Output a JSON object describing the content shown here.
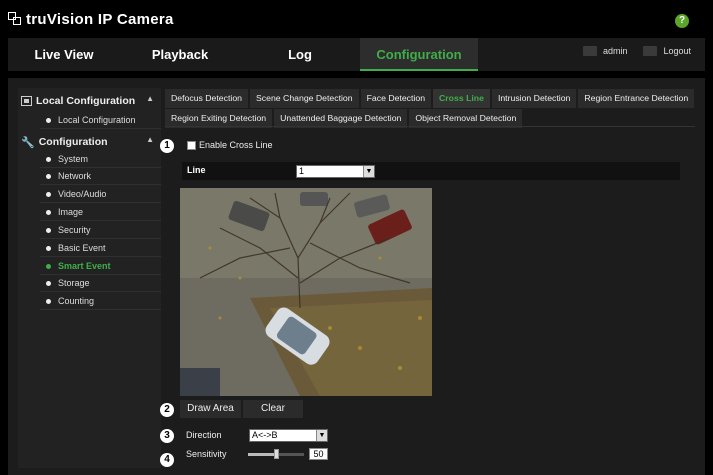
{
  "brand": {
    "name": "truVision IP Camera",
    "help_icon": "help-icon"
  },
  "topnav": {
    "tabs": [
      "Live View",
      "Playback",
      "Log",
      "Configuration"
    ],
    "active": "Configuration",
    "user": "admin",
    "logout": "Logout"
  },
  "sidebar": {
    "local_header": "Local Configuration",
    "local_items": [
      "Local Configuration"
    ],
    "config_header": "Configuration",
    "config_items": [
      "System",
      "Network",
      "Video/Audio",
      "Image",
      "Security",
      "Basic Event",
      "Smart Event",
      "Storage",
      "Counting"
    ],
    "active_item": "Smart Event"
  },
  "tabs_row1": [
    "Defocus Detection",
    "Scene Change Detection",
    "Face Detection",
    "Cross Line",
    "Intrusion Detection",
    "Region Entrance Detection"
  ],
  "tabs_row2": [
    "Region Exiting Detection",
    "Unattended Baggage Detection",
    "Object Removal Detection"
  ],
  "active_tab": "Cross Line",
  "steps": [
    "1",
    "2",
    "3",
    "4"
  ],
  "form": {
    "enable_label": "Enable Cross Line",
    "enable_checked": false,
    "line_label": "Line",
    "line_value": "1",
    "draw_area": "Draw Area",
    "clear": "Clear",
    "direction_label": "Direction",
    "direction_value": "A<->B",
    "sensitivity_label": "Sensitivity",
    "sensitivity_value": "50"
  },
  "colors": {
    "accent": "#3fae49",
    "background": "#000000",
    "panel": "#1c1c1c"
  }
}
